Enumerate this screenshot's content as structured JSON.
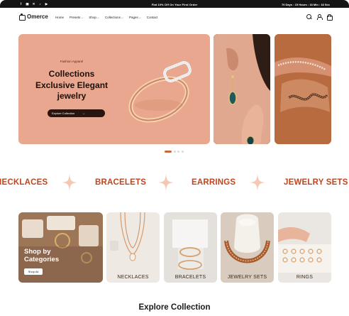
{
  "topbar": {
    "promo": "Flat 10% Off On Your First Order",
    "timer": "70 Days : 15 Hours : 18 Min : 18 Sec",
    "socials": [
      "facebook-icon",
      "instagram-icon",
      "x-icon",
      "tiktok-icon",
      "youtube-icon"
    ]
  },
  "header": {
    "logo": "Omerce",
    "nav": [
      {
        "label": "Home",
        "dropdown": false
      },
      {
        "label": "Presets",
        "dropdown": true
      },
      {
        "label": "Shop",
        "dropdown": true
      },
      {
        "label": "Collections",
        "dropdown": true
      },
      {
        "label": "Pages",
        "dropdown": true
      },
      {
        "label": "Contact",
        "dropdown": false
      }
    ],
    "icons": [
      "search-icon",
      "user-icon",
      "bag-icon"
    ]
  },
  "hero": {
    "eyebrow": "Fashion Apparel",
    "title_line1": "Collections",
    "title_line2": "Exclusive Elegant",
    "title_line3": "jewelry",
    "cta": "Explore Collection",
    "slides_total": 4,
    "active_slide": 1
  },
  "marquee": [
    "NECKLACES",
    "BRACELETS",
    "EARRINGS",
    "JEWELRY SETS"
  ],
  "categories": {
    "shop_title_line1": "Shop by",
    "shop_title_line2": "Categories",
    "shop_button": "Shop All",
    "items": [
      "NECKLACES",
      "BRACELETS",
      "JEWELRY SETS",
      "RINGS"
    ]
  },
  "section_title": "Explore Collection",
  "colors": {
    "accent": "#c0451f",
    "hero_bg": "#e8a78e",
    "dark": "#141414",
    "dot_active": "#c8693b"
  }
}
